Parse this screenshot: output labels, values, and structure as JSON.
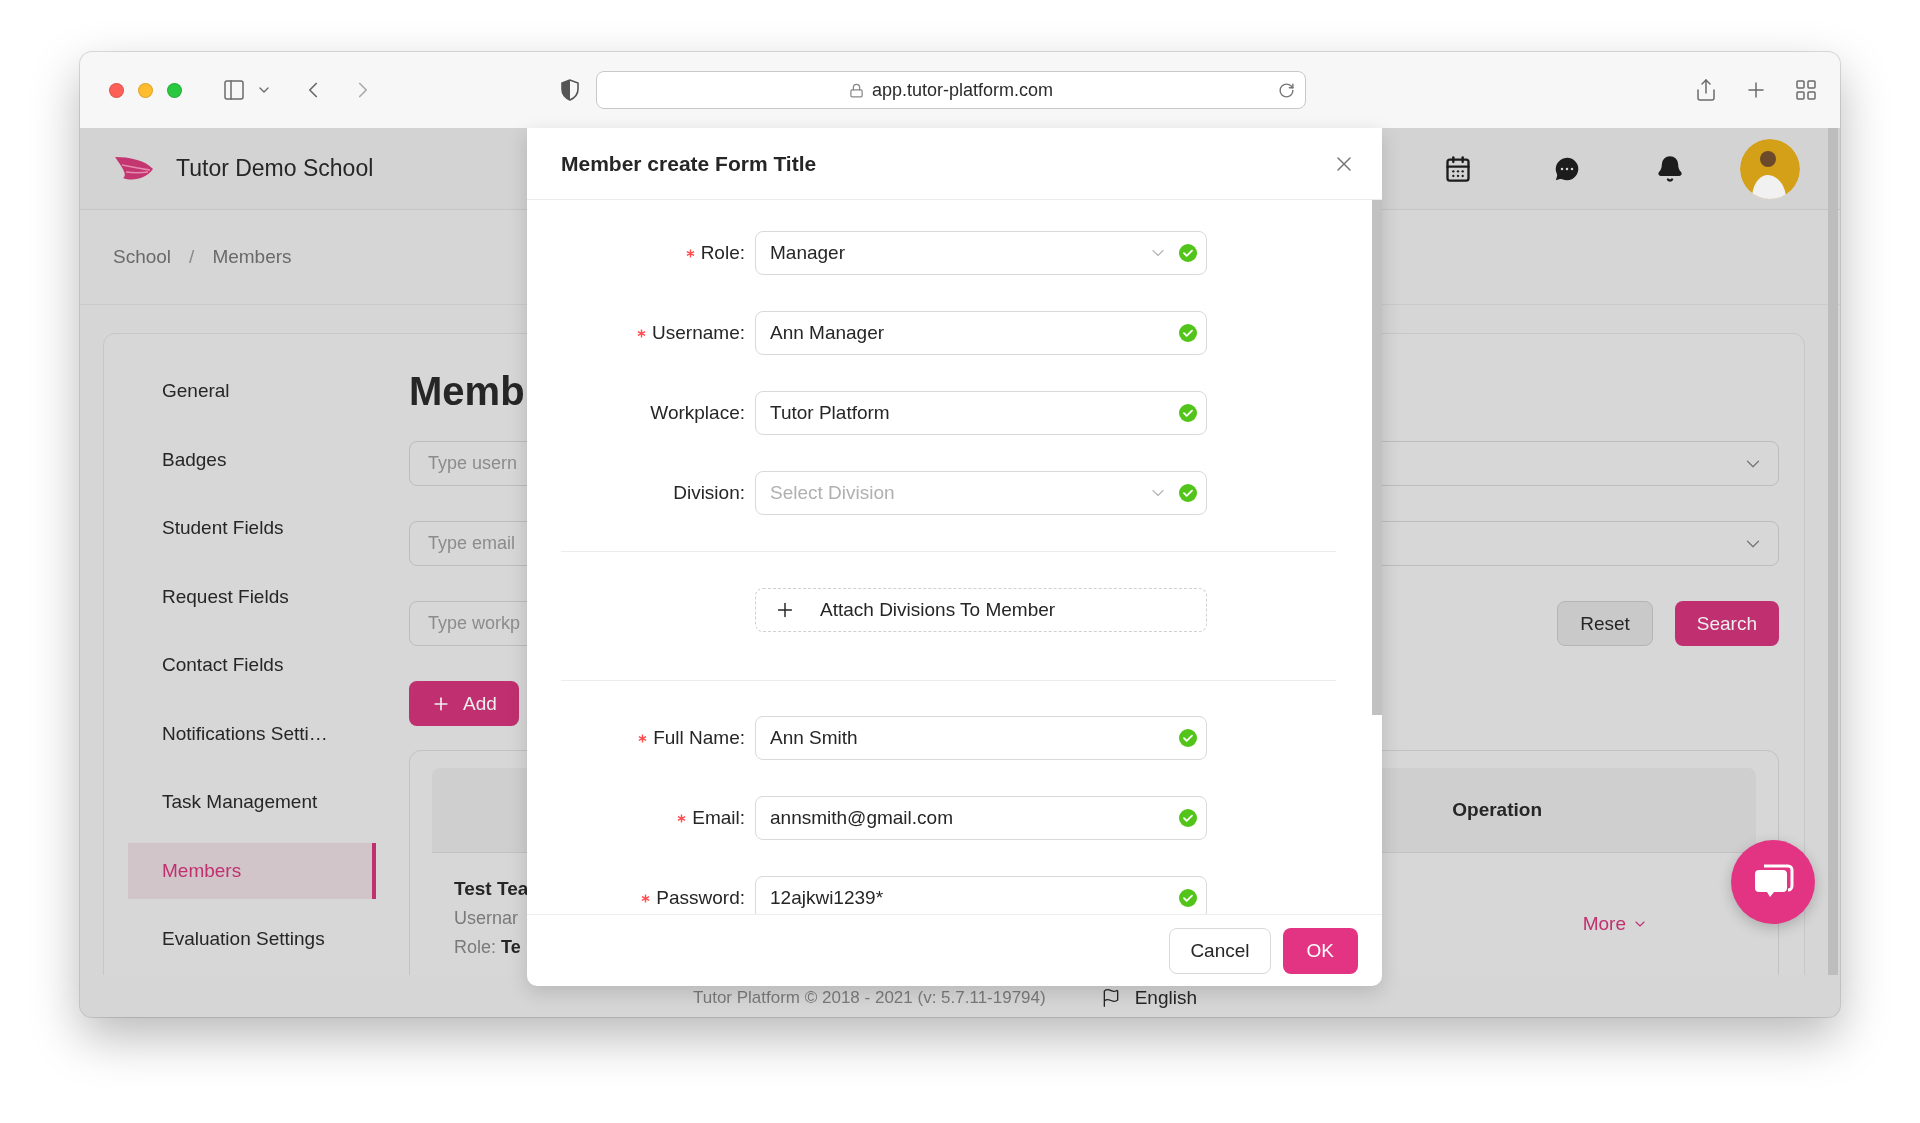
{
  "browser": {
    "url": "app.tutor-platform.com"
  },
  "header": {
    "school_name": "Tutor Demo School"
  },
  "breadcrumb": {
    "items": [
      "School",
      "Members"
    ],
    "separator": "/"
  },
  "sidebar": {
    "items": [
      {
        "label": "General",
        "selected": false
      },
      {
        "label": "Badges",
        "selected": false
      },
      {
        "label": "Student Fields",
        "selected": false
      },
      {
        "label": "Request Fields",
        "selected": false
      },
      {
        "label": "Contact Fields",
        "selected": false
      },
      {
        "label": "Notifications Setti…",
        "selected": false
      },
      {
        "label": "Task Management",
        "selected": false
      },
      {
        "label": "Members",
        "selected": true
      },
      {
        "label": "Evaluation Settings",
        "selected": false
      }
    ]
  },
  "content": {
    "title": "Memb",
    "filters": [
      {
        "kind": "input",
        "placeholder": "Type usern"
      },
      {
        "kind": "select"
      },
      {
        "kind": "input",
        "placeholder": "Type email"
      },
      {
        "kind": "select"
      },
      {
        "kind": "input",
        "placeholder": "Type workp"
      }
    ],
    "reset_button": "Reset",
    "search_button": "Search",
    "add_button": "Add",
    "table": {
      "columns": [
        "Operation"
      ],
      "rows": [
        {
          "name": "Test Tea",
          "lines": [
            "Usernar",
            "Role: **Te**"
          ],
          "action": "More"
        }
      ]
    }
  },
  "modal": {
    "title": "Member create Form Title",
    "fields_top": [
      {
        "label": "Role:",
        "required": true,
        "kind": "select",
        "value": "Manager",
        "valid": true
      },
      {
        "label": "Username:",
        "required": true,
        "kind": "input",
        "value": "Ann Manager",
        "valid": true
      },
      {
        "label": "Workplace:",
        "required": false,
        "kind": "input",
        "value": "Tutor Platform",
        "valid": true
      },
      {
        "label": "Division:",
        "required": false,
        "kind": "select",
        "placeholder": "Select Division",
        "valid": true
      }
    ],
    "attach_button": "Attach Divisions To Member",
    "fields_bottom": [
      {
        "label": "Full Name:",
        "required": true,
        "kind": "input",
        "value": "Ann Smith",
        "valid": true
      },
      {
        "label": "Email:",
        "required": true,
        "kind": "input",
        "value": "annsmith@gmail.com",
        "valid": true
      },
      {
        "label": "Password:",
        "required": true,
        "kind": "input",
        "value": "12ajkwi1239*",
        "valid": true
      }
    ],
    "cancel_button": "Cancel",
    "ok_button": "OK"
  },
  "footer": {
    "copyright": "Tutor Platform © 2018 - 2021 (v: 5.7.11-19794)",
    "language": "English"
  }
}
